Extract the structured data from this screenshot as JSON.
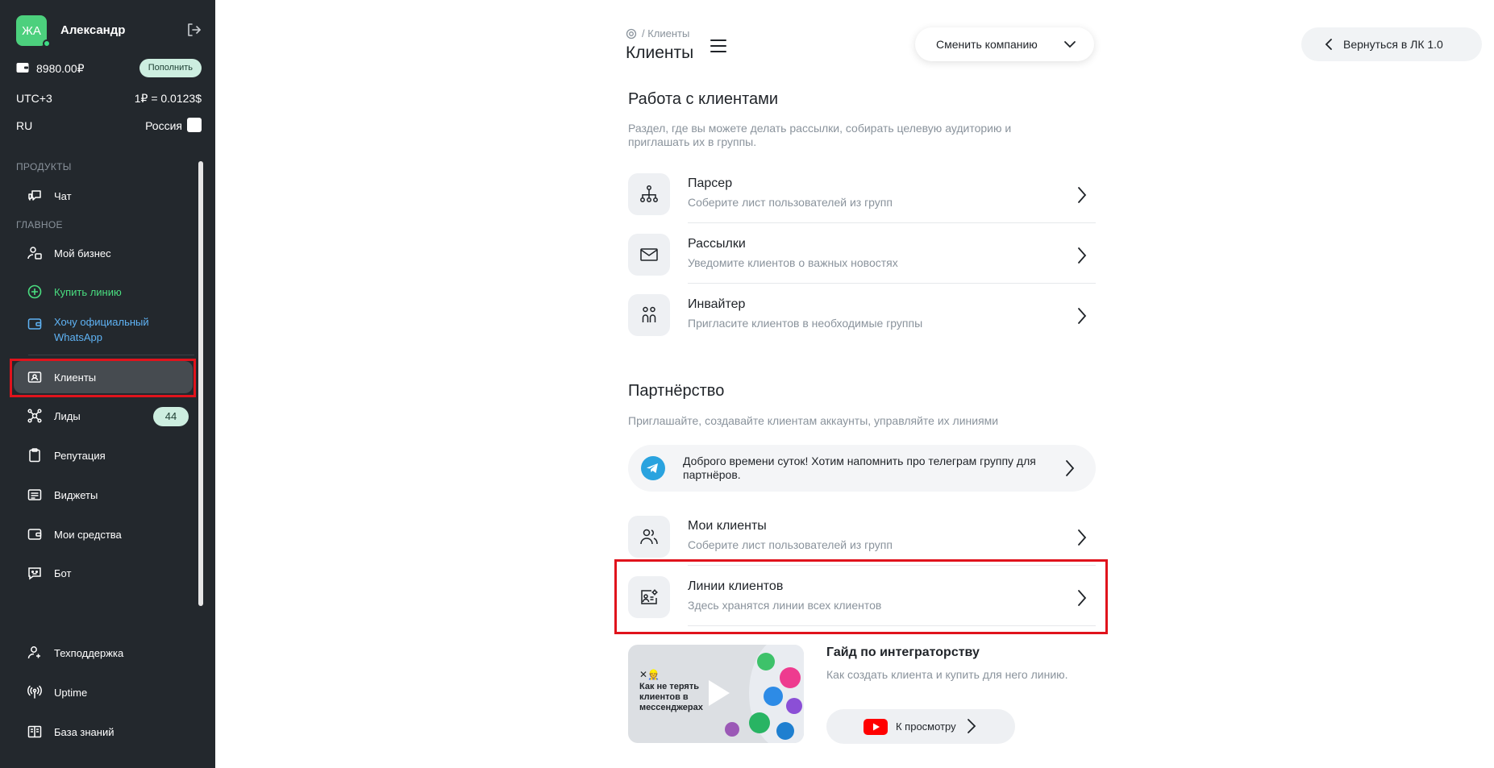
{
  "sidebar": {
    "user": {
      "initials": "ЖА",
      "name": "Александр"
    },
    "balance": "8980.00₽",
    "topup_label": "Пополнить",
    "timezone": "UTC+3",
    "rate": "1₽ = 0.0123$",
    "lang": "RU",
    "country": "Россия",
    "sections": {
      "products": "ПРОДУКТЫ",
      "main": "ГЛАВНОЕ"
    },
    "items": [
      {
        "label": "Чат",
        "icon": "chat-icon"
      },
      {
        "label": "Мой бизнес",
        "icon": "business-icon"
      },
      {
        "label": "Купить линию",
        "icon": "plus-circle-icon"
      },
      {
        "label": "Хочу официальный WhatsApp",
        "icon": "wallet-icon"
      },
      {
        "label": "Клиенты",
        "icon": "contact-card-icon"
      },
      {
        "label": "Лиды",
        "icon": "network-icon",
        "badge": "44"
      },
      {
        "label": "Репутация",
        "icon": "clipboard-icon"
      },
      {
        "label": "Виджеты",
        "icon": "list-icon"
      },
      {
        "label": "Мои средства",
        "icon": "wallet-icon"
      },
      {
        "label": "Бот",
        "icon": "bot-icon"
      },
      {
        "label": "Техподдержка",
        "icon": "support-icon"
      },
      {
        "label": "Uptime",
        "icon": "antenna-icon"
      },
      {
        "label": "База знаний",
        "icon": "book-icon"
      }
    ],
    "colors": {
      "bg": "#23282d",
      "accent_green": "#4ade80",
      "accent_blue": "#5fb3f5",
      "highlight": "#e0131c"
    }
  },
  "header": {
    "breadcrumb": "/ Клиенты",
    "title": "Клиенты",
    "company_button": "Сменить компанию",
    "back_button": "Вернуться в ЛК 1.0"
  },
  "clients_work": {
    "heading": "Работа с клиентами",
    "description": "Раздел, где вы можете делать рассылки, собирать целевую аудиторию и приглашать их в группы.",
    "rows": [
      {
        "title": "Парсер",
        "sub": "Соберите лист пользователей из групп",
        "icon": "hierarchy-icon"
      },
      {
        "title": "Рассылки",
        "sub": "Уведомите клиентов о важных новостях",
        "icon": "mail-icon"
      },
      {
        "title": "Инвайтер",
        "sub": "Пригласите клиентов в необходимые группы",
        "icon": "people-icon"
      }
    ]
  },
  "partnership": {
    "heading": "Партнёрство",
    "description": "Приглашайте, создавайте клиентам аккаунты, управляйте их линиями",
    "telegram_banner": "Доброго времени суток! Хотим напомнить про телеграм группу для партнёров.",
    "rows": [
      {
        "title": "Мои клиенты",
        "sub": "Соберите лист пользователей из групп",
        "icon": "users-icon"
      },
      {
        "title": "Линии клиентов",
        "sub": "Здесь хранятся линии всех клиентов",
        "icon": "card-gear-icon"
      }
    ]
  },
  "guide": {
    "thumb_text": "Как не терять клиентов в мессенджерах",
    "thumb_mark": "✕👷",
    "title": "Гайд по интеграторству",
    "description": "Как создать клиента и купить для него линию.",
    "watch_label": "К просмотру"
  }
}
